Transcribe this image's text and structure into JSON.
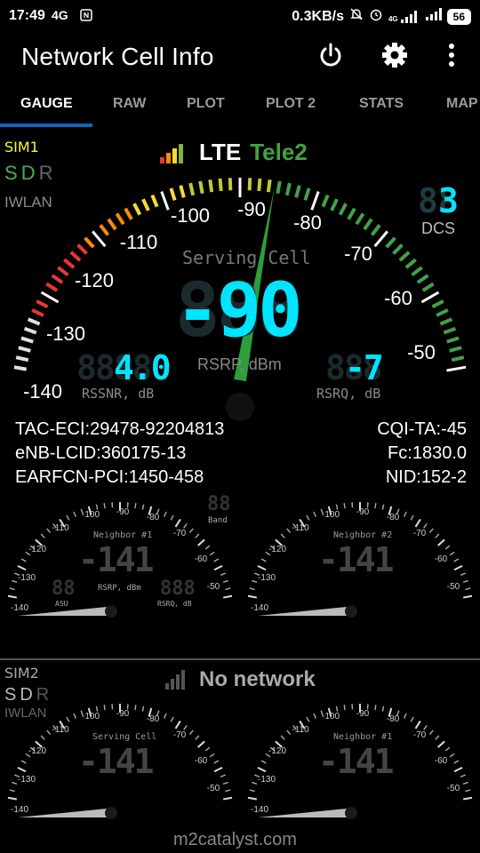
{
  "status": {
    "time": "17:49",
    "net_type": "4G",
    "speed": "0.3KB/s",
    "net_small": "4G",
    "battery": "56"
  },
  "app": {
    "title": "Network Cell Info"
  },
  "tabs": [
    "GAUGE",
    "RAW",
    "PLOT",
    "PLOT 2",
    "STATS",
    "MAP"
  ],
  "sim1": {
    "label": "SIM1",
    "s": "S",
    "d": "D",
    "r": "R",
    "iwlan": "IWLAN",
    "tech": "LTE",
    "operator": "Tele2",
    "gauge_caption": "Serving Cell",
    "big_value": "-90",
    "big_unit": "RSRP, dBm",
    "rssnr_value": "4.0",
    "rssnr_label": "RSSNR, dB",
    "rsrq_value": "-7",
    "rsrq_label": "RSRQ, dB",
    "dcs_value": "3",
    "dcs_label": "DCS",
    "scale": [
      "-140",
      "-130",
      "-120",
      "-110",
      "-100",
      "-90",
      "-80",
      "-70",
      "-60",
      "-50"
    ],
    "needle_value": -90
  },
  "info": {
    "tac_eci": "TAC-ECI:29478-92204813",
    "enb_lcid": "eNB-LCID:360175-13",
    "earfcn_pci": "EARFCN-PCI:1450-458",
    "cqi_ta": "CQI-TA:-45",
    "fc": "Fc:1830.0",
    "nid": "NID:152-2"
  },
  "small_scale": [
    "-140",
    "-130",
    "-120",
    "-110",
    "-100",
    "-90",
    "-80",
    "-70",
    "-60",
    "-50"
  ],
  "neighbor1": {
    "caption": "Neighbor #1",
    "value": "-141",
    "unit": "RSRP, dBm",
    "asu_label": "ASU",
    "rsrq_label": "RSRQ, dB",
    "band_label": "Band"
  },
  "neighbor2": {
    "caption": "Neighbor #2",
    "value": "-141"
  },
  "sim2": {
    "label": "SIM2",
    "s": "S",
    "d": "D",
    "r": "R",
    "iwlan": "IWLAN",
    "status": "No network",
    "serving_caption": "Serving Cell",
    "serving_value": "-141",
    "neighbor_caption": "Neighbor #1",
    "neighbor_value": "-141"
  },
  "footer": {
    "brand": "m2catalyst.com"
  },
  "colors": {
    "accent_blue": "#1565c0",
    "green": "#4caf50",
    "cyan_digits": "#00e5ff",
    "operator_green": "#43a047",
    "sim_yellow": "#f5f542"
  }
}
